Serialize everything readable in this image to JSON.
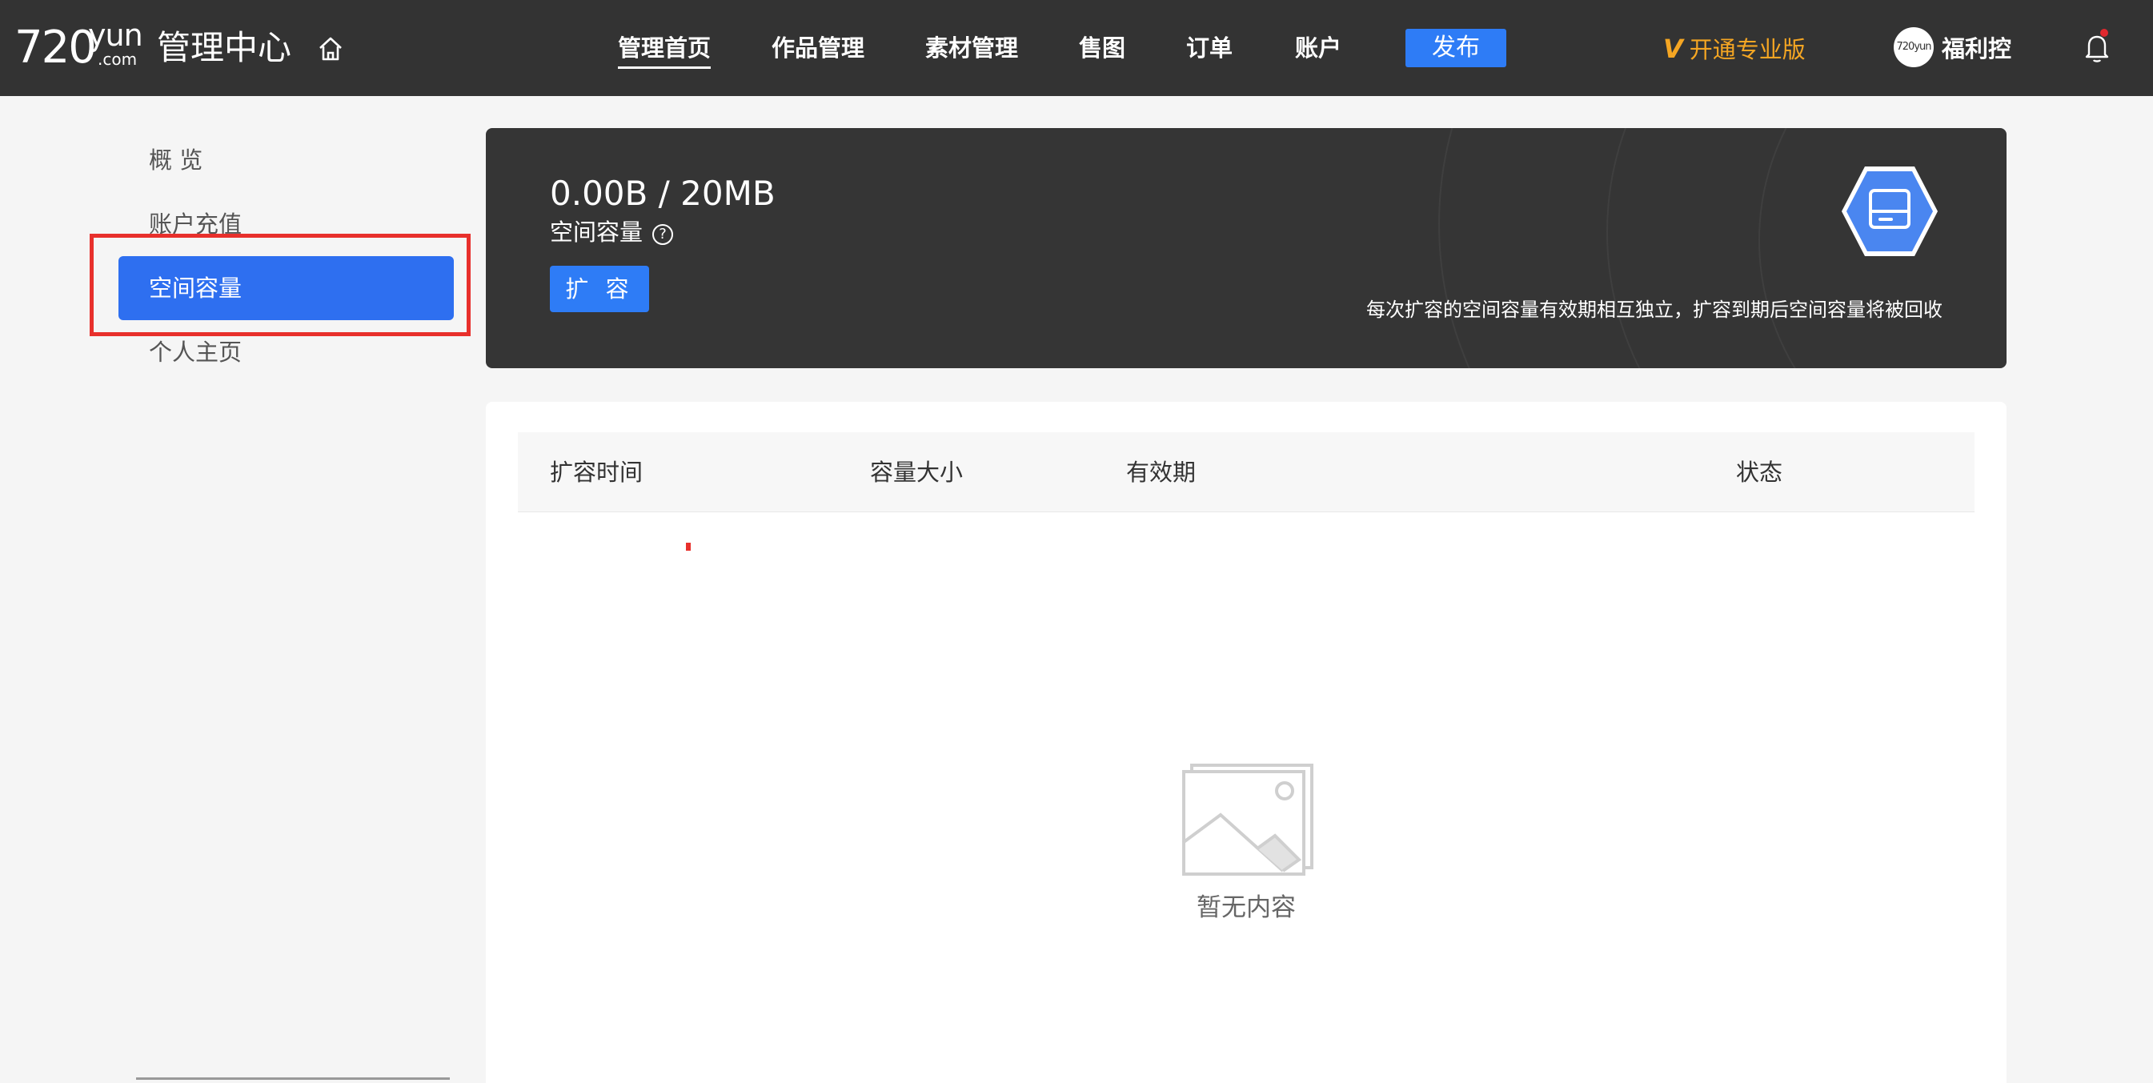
{
  "header": {
    "logo_num": "720",
    "logo_yun": "yun",
    "logo_com": ".com",
    "title": "管理中心",
    "nav": [
      {
        "label": "管理首页"
      },
      {
        "label": "作品管理"
      },
      {
        "label": "素材管理"
      },
      {
        "label": "售图"
      },
      {
        "label": "订单"
      },
      {
        "label": "账户"
      }
    ],
    "publish_label": "发布",
    "pro_v": "V",
    "pro_label": "开通专业版",
    "avatar_text": "720yun",
    "username": "福利控"
  },
  "sidebar": {
    "items": [
      {
        "label": "概 览"
      },
      {
        "label": "账户充值"
      },
      {
        "label": "空间容量"
      },
      {
        "label": "个人主页"
      }
    ]
  },
  "capacity": {
    "value": "0.00B / 20MB",
    "label": "空间容量",
    "help_symbol": "?",
    "expand_label": "扩 容",
    "note": "每次扩容的空间容量有效期相互独立，扩容到期后空间容量将被回收"
  },
  "table": {
    "columns": [
      "扩容时间",
      "容量大小",
      "有效期",
      "状态"
    ],
    "rows": [],
    "empty_text": "暂无内容"
  },
  "colors": {
    "topbar": "#333333",
    "accent": "#2e7cf6",
    "pro": "#f5a623",
    "highlight_box": "#e8302c"
  }
}
